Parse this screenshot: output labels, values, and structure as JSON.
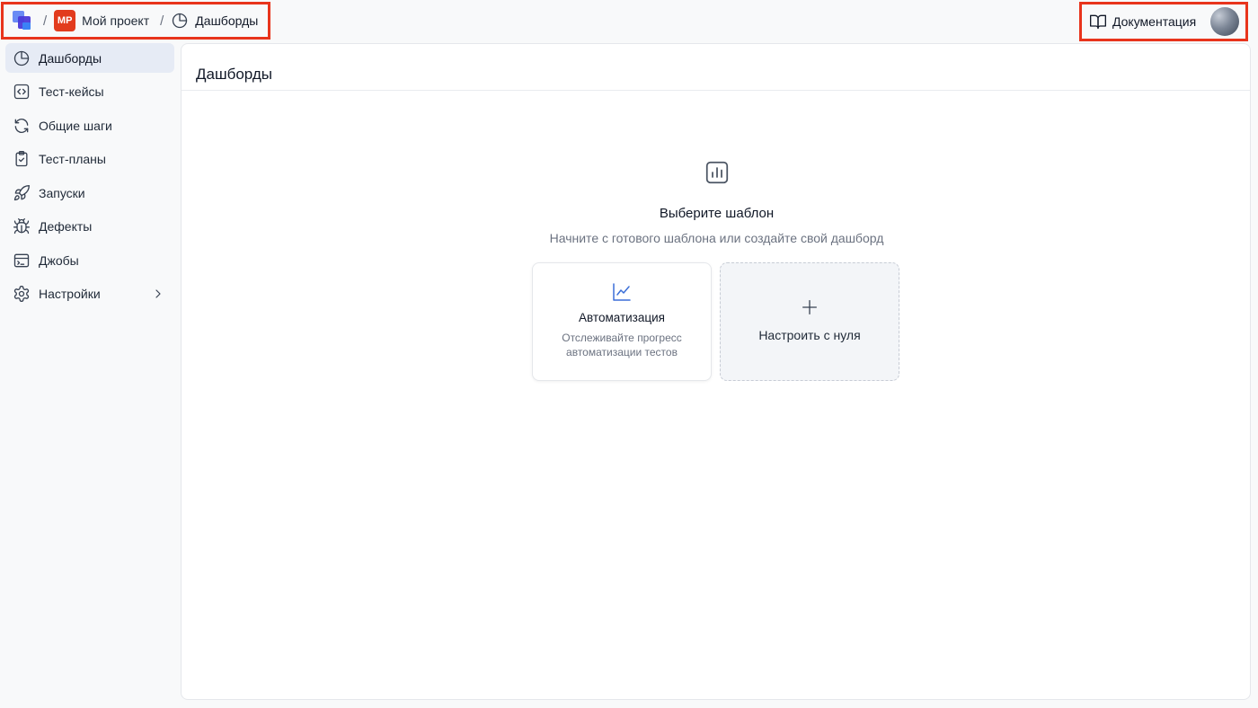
{
  "topbar": {
    "project_initials": "MP",
    "project_name": "Мой проект",
    "separator": "/",
    "current_page": "Дашборды",
    "docs_label": "Документация"
  },
  "sidebar": {
    "items": [
      {
        "label": "Дашборды",
        "icon": "pie-chart-icon",
        "active": true
      },
      {
        "label": "Тест-кейсы",
        "icon": "code-icon"
      },
      {
        "label": "Общие шаги",
        "icon": "refresh-icon"
      },
      {
        "label": "Тест-планы",
        "icon": "clipboard-check-icon"
      },
      {
        "label": "Запуски",
        "icon": "rocket-icon"
      },
      {
        "label": "Дефекты",
        "icon": "bug-icon"
      },
      {
        "label": "Джобы",
        "icon": "terminal-icon"
      },
      {
        "label": "Настройки",
        "icon": "gear-icon",
        "has_chevron": true
      }
    ]
  },
  "main": {
    "title": "Дашборды",
    "empty_state": {
      "icon": "bar-chart-icon",
      "title": "Выберите шаблон",
      "subtitle": "Начните с готового шаблона или создайте свой дашборд"
    },
    "cards": [
      {
        "title": "Автоматизация",
        "description": "Отслеживайте прогресс автоматизации тестов",
        "icon": "line-chart-icon"
      },
      {
        "title": "Настроить с нуля",
        "icon": "plus-icon"
      }
    ]
  },
  "colors": {
    "highlight_border": "#e8341c",
    "project_badge": "#e23b1d",
    "active_nav_bg": "#e6ebf5",
    "accent_blue": "#3b6fd8"
  }
}
